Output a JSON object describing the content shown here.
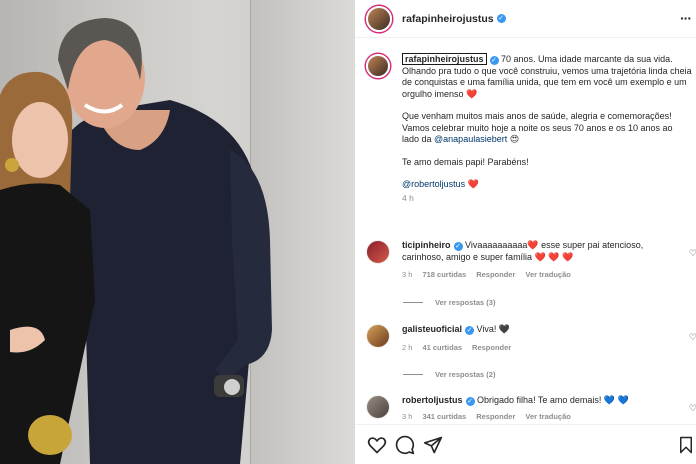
{
  "post": {
    "username": "rafapinheirojustus",
    "verified_badge": "✓"
  },
  "caption": {
    "username": "rafapinheirojustus",
    "p1": "70 anos. Uma idade marcante da sua vida. Olhando pra tudo o que você construiu, vemos uma trajetória linda cheia de conquistas e uma família unida, que tem em você um exemplo e um orgulho imenso",
    "p1_emoji": "❤️",
    "p2_start": "Que venham muitos mais anos de saúde, alegria e comemorações! Vamos celebrar muito hoje a noite os seus 70 anos e os 10 anos ao lado da ",
    "p2_mention": "@anapaulasiebert",
    "p2_emoji": "😍",
    "p3": "Te amo demais papi! Parabéns!",
    "p4_mention": "@robertoljustus",
    "p4_emoji": "❤️",
    "time": "4 h"
  },
  "comments": [
    {
      "username": "ticipinheiro",
      "text": "Vivaaaaaaaaaa❤️ esse super pai atencioso, carinhoso, amigo e super família ❤️ ❤️ ❤️",
      "time": "3 h",
      "likes": "718 curtidas",
      "reply": "Responder",
      "translate": "Ver tradução",
      "replies": "Ver respostas (3)"
    },
    {
      "username": "galisteuoficial",
      "text": "Viva! 🖤",
      "time": "2 h",
      "likes": "41 curtidas",
      "reply": "Responder",
      "replies": "Ver respostas (2)"
    },
    {
      "username": "robertoljustus",
      "text": "Obrigado filha! Te amo demais! 💙 💙",
      "time": "3 h",
      "likes": "341 curtidas",
      "reply": "Responder",
      "translate": "Ver tradução"
    }
  ],
  "icons": {
    "like": "heart-icon",
    "comment": "comment-icon",
    "share": "share-icon",
    "save": "bookmark-icon"
  },
  "colors": {
    "verified": "#3897f0",
    "mention": "#00376b",
    "muted": "#8e8e8e",
    "heart": "#ed4956"
  }
}
